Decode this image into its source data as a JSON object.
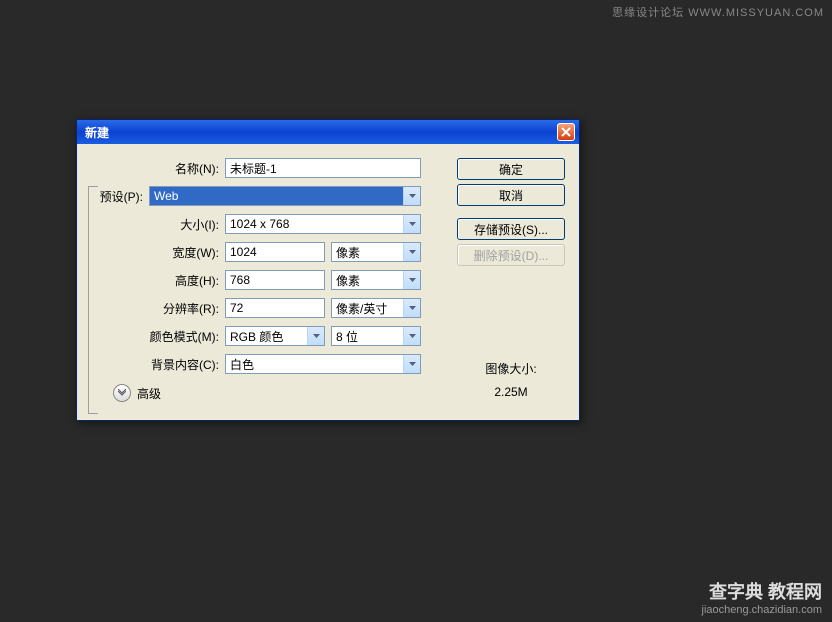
{
  "watermark": {
    "top": "思缘设计论坛 WWW.MISSYUAN.COM",
    "bottom_line1": "查字典 教程网",
    "bottom_line2": "jiaocheng.chazidian.com"
  },
  "dialog": {
    "title": "新建",
    "labels": {
      "name": "名称(N):",
      "preset": "预设(P):",
      "size": "大小(I):",
      "width": "宽度(W):",
      "height": "高度(H):",
      "resolution": "分辨率(R):",
      "colormode": "颜色模式(M):",
      "background": "背景内容(C):",
      "advanced": "高级"
    },
    "values": {
      "name": "未标题-1",
      "preset": "Web",
      "size": "1024 x 768",
      "width": "1024",
      "width_unit": "像素",
      "height": "768",
      "height_unit": "像素",
      "resolution": "72",
      "resolution_unit": "像素/英寸",
      "colormode": "RGB 颜色",
      "colordepth": "8 位",
      "background": "白色"
    },
    "buttons": {
      "ok": "确定",
      "cancel": "取消",
      "save_preset": "存储预设(S)...",
      "delete_preset": "删除预设(D)..."
    },
    "info": {
      "label": "图像大小:",
      "value": "2.25M"
    }
  }
}
